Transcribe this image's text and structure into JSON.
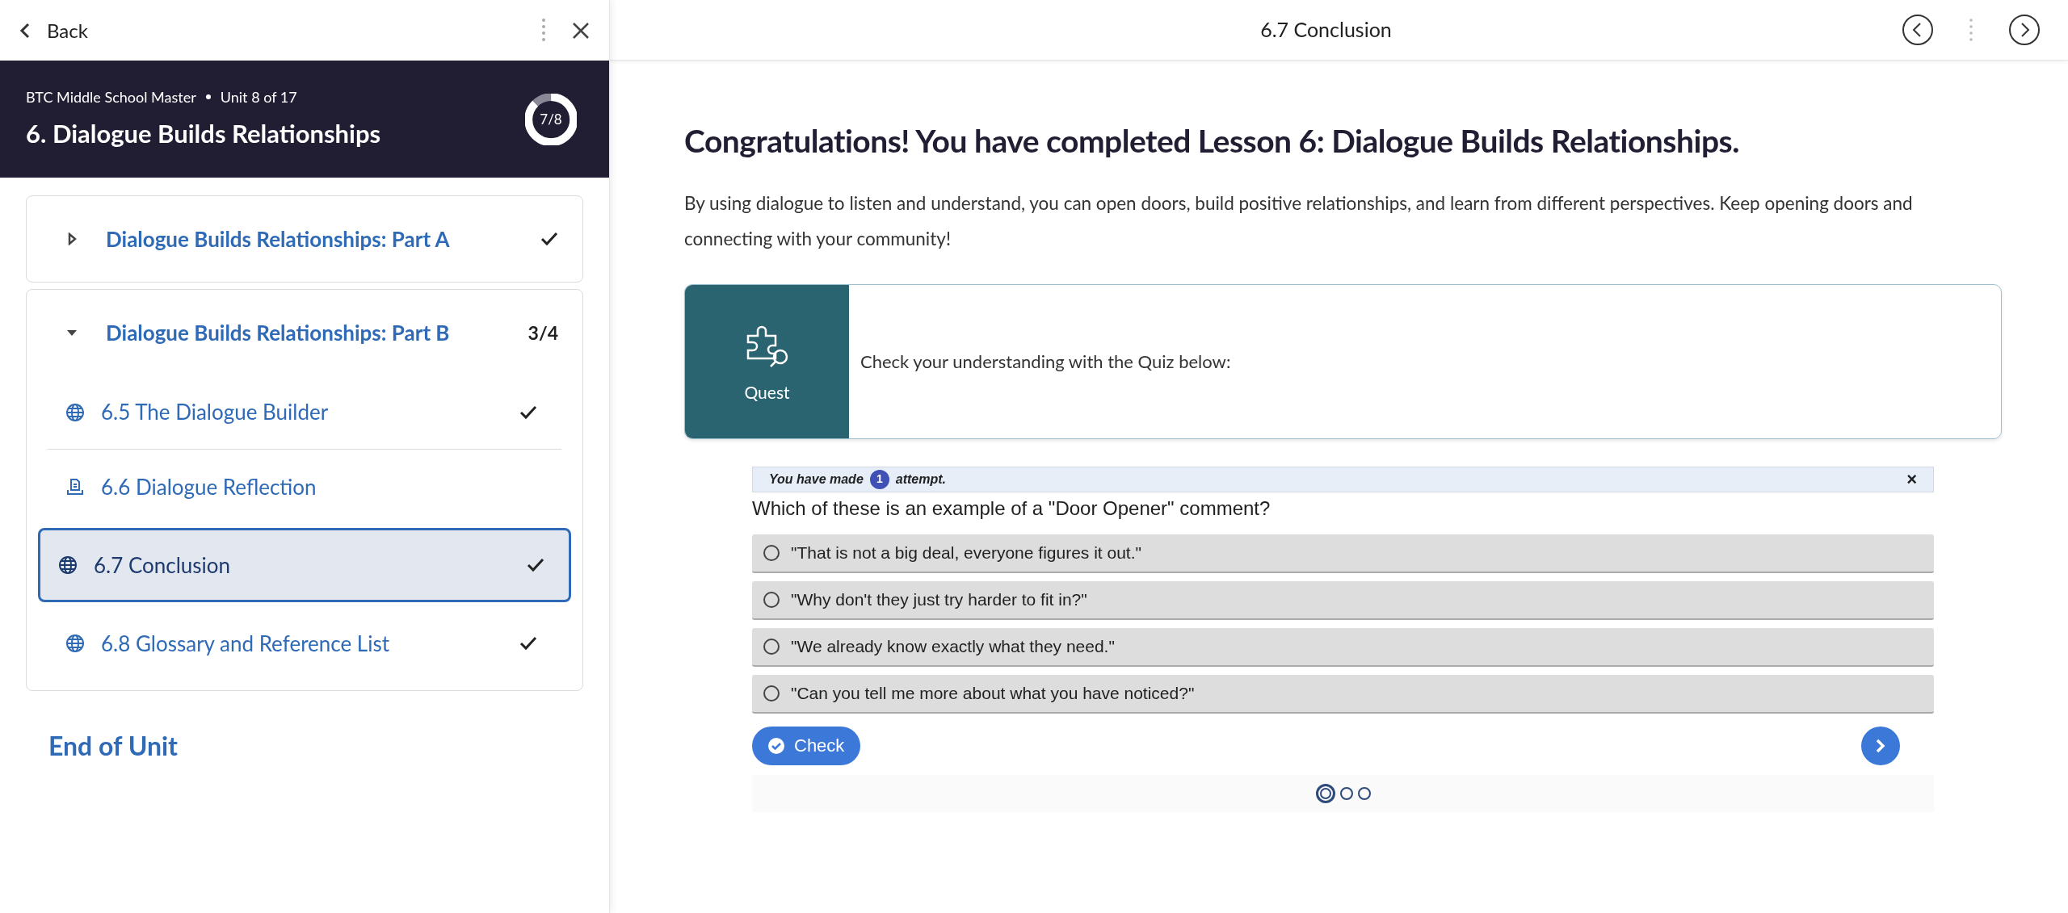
{
  "sidebar": {
    "back": "Back",
    "course": "BTC Middle School Master",
    "unit": "Unit 8 of 17",
    "title": "6. Dialogue Builds Relationships",
    "progress": {
      "text": "7/8",
      "level": 0.875
    },
    "sections": [
      {
        "title": "Dialogue Builds Relationships: Part A",
        "expanded": false,
        "completed": true
      },
      {
        "title": "Dialogue Builds Relationships: Part B",
        "expanded": true,
        "count": "3/4",
        "items": [
          {
            "label": "6.5 The Dialogue Builder",
            "kind": "web",
            "completed": true,
            "selected": false
          },
          {
            "label": "6.6 Dialogue Reflection",
            "kind": "assignment",
            "completed": false,
            "selected": false
          },
          {
            "label": "6.7 Conclusion",
            "kind": "web",
            "completed": true,
            "selected": true
          },
          {
            "label": "6.8 Glossary and Reference List",
            "kind": "web",
            "completed": true,
            "selected": false
          }
        ]
      }
    ],
    "end": "End of Unit"
  },
  "topbar": {
    "title": "6.7 Conclusion"
  },
  "content": {
    "heading": "Congratulations! You have completed Lesson 6: Dialogue Builds Relationships.",
    "paragraph": "By using dialogue to listen and understand, you can open doors, build positive relationships, and learn from different perspectives. Keep opening doors and connecting with your community!",
    "callout": {
      "label": "Quest",
      "text": "Check your understanding with the Quiz below:"
    },
    "quiz": {
      "attempt_before": "You have made",
      "attempt_count": "1",
      "attempt_after": "attempt.",
      "close": "×",
      "question": "Which of these is an example of a \"Door Opener\" comment?",
      "options": [
        {
          "text": "\"That is not a big deal, everyone figures it out.\"",
          "selected": false
        },
        {
          "text": "\"Why don't they just try harder to fit in?\"",
          "selected": false
        },
        {
          "text": "\"We already know exactly what they need.\"",
          "selected": false
        },
        {
          "text": "\"Can you tell me more about what you have noticed?\"",
          "selected": false
        }
      ],
      "check": "Check",
      "pages": [
        {
          "selected": true
        },
        {
          "selected": false
        },
        {
          "selected": false
        }
      ]
    }
  }
}
